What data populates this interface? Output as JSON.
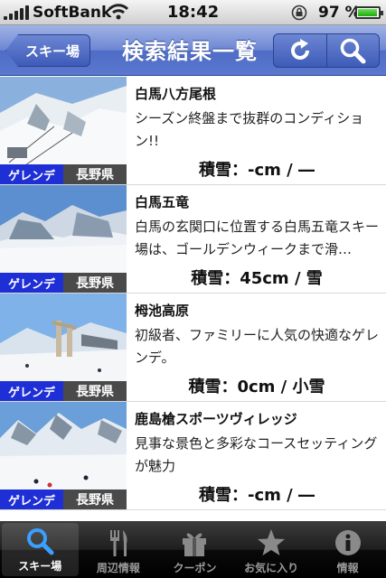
{
  "status_bar": {
    "carrier": "SoftBank",
    "time": "18:42",
    "battery_text": "97 %",
    "battery_level": 0.97
  },
  "nav": {
    "back_label": "スキー場",
    "title": "検索結果一覧"
  },
  "results": [
    {
      "name": "白馬八方尾根",
      "description": "シーズン終盤まで抜群のコンディション!!",
      "genre": "ゲレンデ",
      "prefecture": "長野県",
      "snow": "積雪：-cm / ―"
    },
    {
      "name": "白馬五竜",
      "description": "白馬の玄関口に位置する白馬五竜スキー場は、ゴールデンウィークまで滑…",
      "genre": "ゲレンデ",
      "prefecture": "長野県",
      "snow": "積雪：45cm / 雪"
    },
    {
      "name": "栂池高原",
      "description": "初級者、ファミリーに人気の快適なゲレンデ。",
      "genre": "ゲレンデ",
      "prefecture": "長野県",
      "snow": "積雪：0cm / 小雪"
    },
    {
      "name": "鹿島槍スポーツヴィレッジ",
      "description": "見事な景色と多彩なコースセッティングが魅力",
      "genre": "ゲレンデ",
      "prefecture": "長野県",
      "snow": "積雪：-cm / ―"
    }
  ],
  "tabs": [
    {
      "label": "スキー場",
      "icon": "search-icon",
      "active": true
    },
    {
      "label": "周辺情報",
      "icon": "fork-knife-icon",
      "active": false
    },
    {
      "label": "クーポン",
      "icon": "gift-icon",
      "active": false
    },
    {
      "label": "お気に入り",
      "icon": "star-icon",
      "active": false
    },
    {
      "label": "情報",
      "icon": "info-icon",
      "active": false
    }
  ],
  "colors": {
    "nav_blue": "#5a78cf",
    "genre_tag": "#1f2fd6",
    "pref_tag": "#4a4a4a"
  }
}
